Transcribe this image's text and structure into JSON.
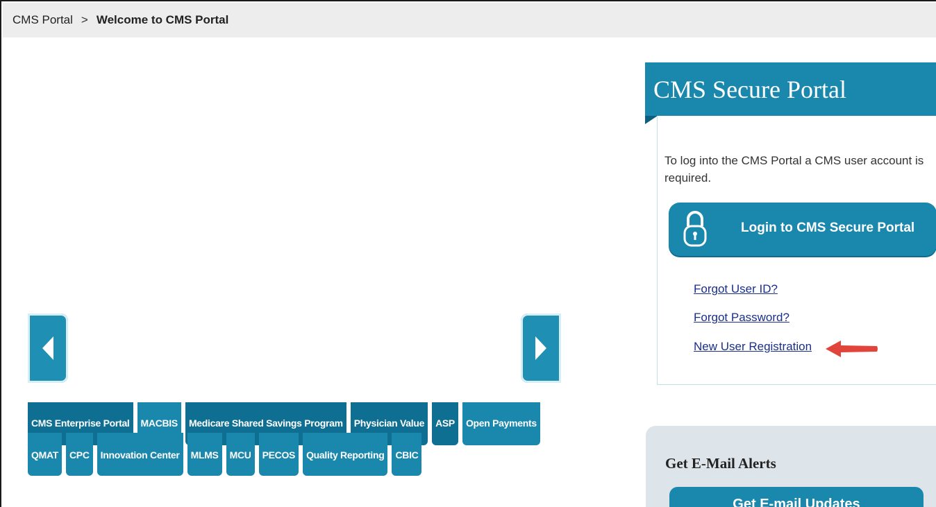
{
  "breadcrumb": {
    "root": "CMS Portal",
    "separator": ">",
    "current": "Welcome to CMS Portal"
  },
  "carousel": {
    "prev_icon": "chevron-left-icon",
    "next_icon": "chevron-right-icon"
  },
  "tabs_row1": [
    "CMS Enterprise Portal",
    "MACBIS",
    "Medicare Shared Savings Program",
    "Physician Value",
    "ASP",
    "Open Payments"
  ],
  "tabs_row2": [
    "QMAT",
    "CPC",
    "Innovation Center",
    "MLMS",
    "MCU",
    "PECOS",
    "Quality Reporting",
    "CBIC"
  ],
  "portal": {
    "title": "CMS Secure Portal",
    "intro": "To log into the CMS Portal a CMS user account is required.",
    "login_label": "Login to CMS Secure Portal",
    "login_icon": "lock-icon",
    "links": [
      "Forgot User ID?",
      "Forgot Password?",
      "New User Registration"
    ]
  },
  "alerts": {
    "title": "Get E-Mail Alerts",
    "button_label": "Get E-mail Updates"
  },
  "colors": {
    "accent": "#1a87ac",
    "link": "#1a2f8a",
    "annotation_arrow": "#e0443a"
  }
}
